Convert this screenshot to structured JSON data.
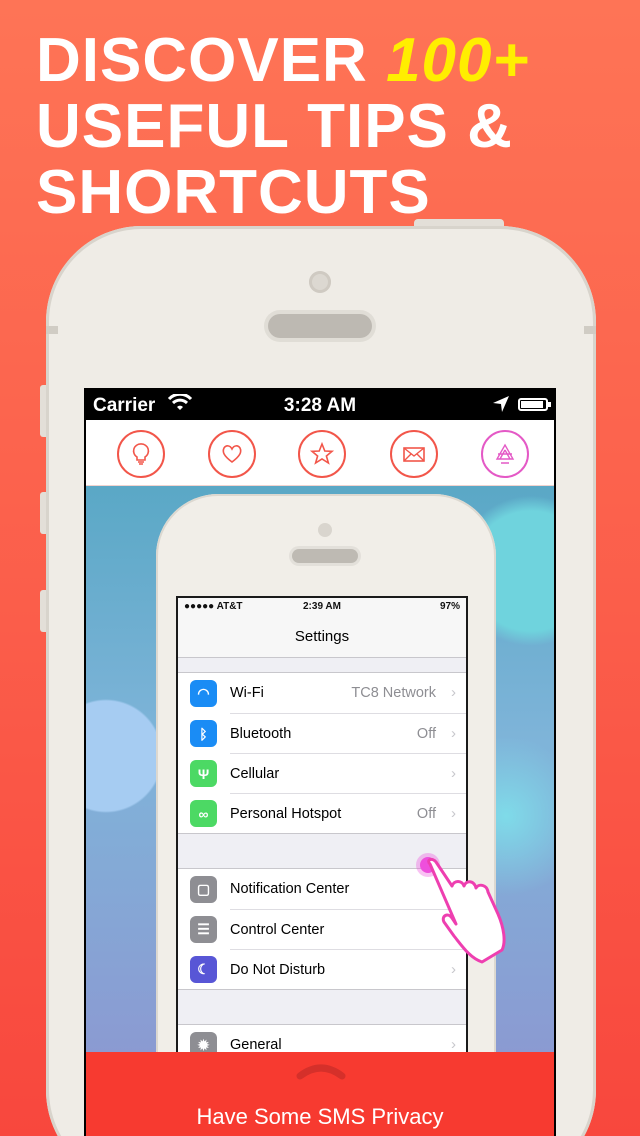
{
  "headline": {
    "line1": "DISCOVER ",
    "highlight": "100+",
    "line2": "USEFUL TIPS &",
    "line3": "SHORTCUTS"
  },
  "status_bar": {
    "carrier": "Carrier",
    "time": "3:28 AM",
    "battery_level": 0.9
  },
  "toolbar": {
    "items": [
      {
        "icon": "lightbulb-icon"
      },
      {
        "icon": "heart-icon"
      },
      {
        "icon": "star-icon"
      },
      {
        "icon": "mail-icon"
      },
      {
        "icon": "triangles-icon"
      }
    ]
  },
  "inner_status": {
    "carrier": "●●●●● AT&T",
    "time": "2:39 AM",
    "battery": "97%"
  },
  "settings": {
    "title": "Settings",
    "group1": [
      {
        "icon": "wifi-icon",
        "color": "#1a8cf5",
        "label": "Wi-Fi",
        "value": "TC8 Network"
      },
      {
        "icon": "bluetooth-icon",
        "color": "#1a8cf5",
        "label": "Bluetooth",
        "value": "Off"
      },
      {
        "icon": "cellular-icon",
        "color": "#4cd964",
        "label": "Cellular",
        "value": ""
      },
      {
        "icon": "hotspot-icon",
        "color": "#4cd964",
        "label": "Personal Hotspot",
        "value": "Off"
      }
    ],
    "group2": [
      {
        "icon": "notification-center-icon",
        "color": "#8e8e93",
        "label": "Notification Center",
        "value": ""
      },
      {
        "icon": "control-center-icon",
        "color": "#8e8e93",
        "label": "Control Center",
        "value": ""
      },
      {
        "icon": "moon-icon",
        "color": "#5856d6",
        "label": "Do Not Disturb",
        "value": ""
      }
    ],
    "group3": [
      {
        "icon": "gear-icon",
        "color": "#8e8e93",
        "label": "General",
        "value": ""
      }
    ]
  },
  "banner": {
    "text": "Have Some SMS Privacy"
  },
  "colors": {
    "accent": "#f2564a",
    "banner": "#f73a30",
    "highlight": "#ffee00",
    "touch": "#ee4fdc"
  }
}
